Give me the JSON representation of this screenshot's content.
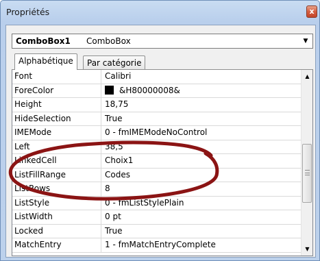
{
  "window": {
    "title": "Propriétés",
    "close_glyph": "x"
  },
  "object_selector": {
    "name": "ComboBox1",
    "type": "ComboBox"
  },
  "tabs": [
    {
      "label": "Alphabétique",
      "active": true
    },
    {
      "label": "Par catégorie",
      "active": false
    }
  ],
  "properties": [
    {
      "name": "Font",
      "value": "Calibri"
    },
    {
      "name": "ForeColor",
      "value": "&H80000008&",
      "swatch": "#000000"
    },
    {
      "name": "Height",
      "value": "18,75"
    },
    {
      "name": "HideSelection",
      "value": "True"
    },
    {
      "name": "IMEMode",
      "value": "0 - fmIMEModeNoControl"
    },
    {
      "name": "Left",
      "value": "38,5"
    },
    {
      "name": "LinkedCell",
      "value": "Choix1"
    },
    {
      "name": "ListFillRange",
      "value": "Codes"
    },
    {
      "name": "ListRows",
      "value": "8"
    },
    {
      "name": "ListStyle",
      "value": "0 - fmListStylePlain"
    },
    {
      "name": "ListWidth",
      "value": "0 pt"
    },
    {
      "name": "Locked",
      "value": "True"
    },
    {
      "name": "MatchEntry",
      "value": "1 - fmMatchEntryComplete"
    }
  ],
  "annotation": {
    "shape": "hand-drawn ellipse",
    "color": "#8b1414"
  },
  "colors": {
    "title_bar": "#c9dcf2",
    "close_button": "#d55e3f",
    "panel": "#f0f0f0"
  }
}
